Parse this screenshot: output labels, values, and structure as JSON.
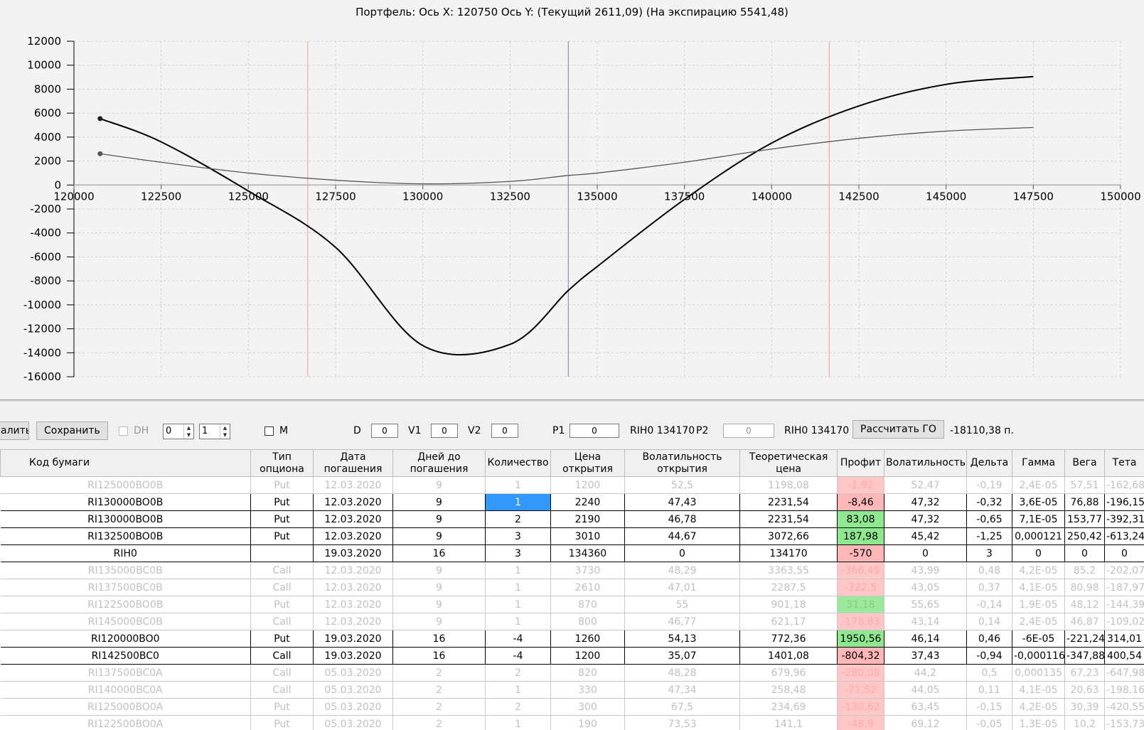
{
  "chart": {
    "title": "Портфель: Ось X: 120750 Ось Y:  (Текущий 2611,09)  (На экспирацию 5541,48)"
  },
  "chart_data": {
    "type": "line",
    "title": "Портфель: Ось X: 120750 Ось Y:  (Текущий 2611,09)  (На экспирацию 5541,48)",
    "xlabel": "",
    "ylabel": "",
    "xlim": [
      120000,
      150000
    ],
    "ylim": [
      -16000,
      12000
    ],
    "x_ticks": [
      "120000",
      "122500",
      "125000",
      "127500",
      "130000",
      "132500",
      "135000",
      "137500",
      "140000",
      "142500",
      "145000",
      "147500",
      "150000"
    ],
    "y_ticks": [
      "12000",
      "10000",
      "8000",
      "6000",
      "4000",
      "2000",
      "0",
      "-2000",
      "-4000",
      "-6000",
      "-8000",
      "-10000",
      "-12000",
      "-14000",
      "-16000"
    ],
    "grid": true,
    "vertical_markers": [
      {
        "x": 126700,
        "color": "#ff9999"
      },
      {
        "x": 134170,
        "color": "#7a7a90"
      },
      {
        "x": 141650,
        "color": "#ff9999"
      }
    ],
    "series": [
      {
        "color": "#000000",
        "points": [
          [
            120750,
            5541
          ],
          [
            122500,
            3600
          ],
          [
            125000,
            -500
          ],
          [
            127500,
            -5200
          ],
          [
            130000,
            -13400
          ],
          [
            132500,
            -13300
          ],
          [
            134170,
            -8800
          ],
          [
            135000,
            -6800
          ],
          [
            137500,
            -1200
          ],
          [
            140000,
            3500
          ],
          [
            142500,
            6600
          ],
          [
            145000,
            8400
          ],
          [
            147500,
            9050
          ]
        ]
      },
      {
        "color": "#555555",
        "points": [
          [
            120750,
            2611
          ],
          [
            122500,
            1900
          ],
          [
            125000,
            1000
          ],
          [
            127500,
            400
          ],
          [
            130000,
            100
          ],
          [
            132500,
            300
          ],
          [
            134170,
            800
          ],
          [
            135000,
            1000
          ],
          [
            137500,
            1900
          ],
          [
            140000,
            3000
          ],
          [
            142500,
            3900
          ],
          [
            145000,
            4500
          ],
          [
            147500,
            4800
          ]
        ]
      }
    ]
  },
  "toolbar": {
    "delete_label": "алить",
    "save_label": "Сохранить",
    "dh_label": "DH",
    "spin1_value": "0",
    "spin2_value": "1",
    "m_label": "M",
    "d_label": "D",
    "d_value": "0",
    "v1_label": "V1",
    "v1_value": "0",
    "v2_label": "V2",
    "v2_value": "0",
    "p1_label": "P1",
    "p1_value": "0",
    "p1_instrument": "RIH0 134170",
    "p2_label": "P2",
    "p2_value": "0",
    "p2_instrument": "RIH0 134170",
    "calc_label": "Рассчитать ГО",
    "result": "-18110,38 п."
  },
  "table": {
    "headers": [
      "Код бумаги",
      "Тип\nопциона",
      "Дата\nпогашения",
      "Дней до\nпогашения",
      "Количество",
      "Цена\nоткрытия",
      "Волатильность\nоткрытия",
      "Теоретическая\nцена",
      "Профит",
      "Волатильность",
      "Дельта",
      "Гамма",
      "Вега",
      "Тета"
    ],
    "rows": [
      {
        "faded": true,
        "pl": "neg",
        "sel": false,
        "cells": [
          "RI125000BO0B",
          "Put",
          "12.03.2020",
          "9",
          "1",
          "1200",
          "52,5",
          "1198,08",
          "-1,92",
          "52,47",
          "-0,19",
          "2,4E-05",
          "57,51",
          "-162,68"
        ]
      },
      {
        "faded": false,
        "pl": "neg",
        "sel": true,
        "cells": [
          "RI130000BO0B",
          "Put",
          "12.03.2020",
          "9",
          "1",
          "2240",
          "47,43",
          "2231,54",
          "-8,46",
          "47,32",
          "-0,32",
          "3,6E-05",
          "76,88",
          "-196,15"
        ]
      },
      {
        "faded": false,
        "pl": "pos",
        "sel": false,
        "cells": [
          "RI130000BO0B",
          "Put",
          "12.03.2020",
          "9",
          "2",
          "2190",
          "46,78",
          "2231,54",
          "83,08",
          "47,32",
          "-0,65",
          "7,1E-05",
          "153,77",
          "-392,31"
        ]
      },
      {
        "faded": false,
        "pl": "pos",
        "sel": false,
        "cells": [
          "RI132500BO0B",
          "Put",
          "12.03.2020",
          "9",
          "3",
          "3010",
          "44,67",
          "3072,66",
          "187,98",
          "45,42",
          "-1,25",
          "0,000121",
          "250,42",
          "-613,24"
        ]
      },
      {
        "faded": false,
        "pl": "neg",
        "sel": false,
        "cells": [
          "RIH0",
          "",
          "19.03.2020",
          "16",
          "3",
          "134360",
          "0",
          "134170",
          "-570",
          "0",
          "3",
          "0",
          "0",
          "0"
        ]
      },
      {
        "faded": true,
        "pl": "neg",
        "sel": false,
        "cells": [
          "RI135000BC0B",
          "Call",
          "12.03.2020",
          "9",
          "1",
          "3730",
          "48,29",
          "3363,55",
          "-366,45",
          "43,99",
          "0,48",
          "4,2E-05",
          "85,2",
          "-202,07"
        ]
      },
      {
        "faded": true,
        "pl": "neg",
        "sel": false,
        "cells": [
          "RI137500BC0B",
          "Call",
          "12.03.2020",
          "9",
          "1",
          "2610",
          "47,01",
          "2287,5",
          "-322,5",
          "43,05",
          "0,37",
          "4,1E-05",
          "80,98",
          "-187,97"
        ]
      },
      {
        "faded": true,
        "pl": "pos",
        "sel": false,
        "cells": [
          "RI122500BO0B",
          "Put",
          "12.03.2020",
          "9",
          "1",
          "870",
          "55",
          "901,18",
          "31,18",
          "55,65",
          "-0,14",
          "1,9E-05",
          "48,12",
          "-144,39"
        ]
      },
      {
        "faded": true,
        "pl": "neg",
        "sel": false,
        "cells": [
          "RI145000BC0B",
          "Call",
          "12.03.2020",
          "9",
          "1",
          "800",
          "46,77",
          "621,17",
          "-178,83",
          "43,14",
          "0,14",
          "2,4E-05",
          "46,87",
          "-109,02"
        ]
      },
      {
        "faded": false,
        "pl": "pos",
        "sel": false,
        "cells": [
          "RI120000BO0",
          "Put",
          "19.03.2020",
          "16",
          "-4",
          "1260",
          "54,13",
          "772,36",
          "1950,56",
          "46,14",
          "0,46",
          "-6E-05",
          "-221,24",
          "314,01"
        ]
      },
      {
        "faded": false,
        "pl": "neg",
        "sel": false,
        "cells": [
          "RI142500BC0",
          "Call",
          "19.03.2020",
          "16",
          "-4",
          "1200",
          "35,07",
          "1401,08",
          "-804,32",
          "37,43",
          "-0,94",
          "-0,000116",
          "-347,88",
          "400,54"
        ]
      },
      {
        "faded": true,
        "pl": "neg",
        "sel": false,
        "cells": [
          "RI137500BC0A",
          "Call",
          "05.03.2020",
          "2",
          "2",
          "820",
          "48,28",
          "679,96",
          "-280,08",
          "44,2",
          "0,5",
          "0,000135",
          "67,23",
          "-647,98"
        ]
      },
      {
        "faded": true,
        "pl": "neg",
        "sel": false,
        "cells": [
          "RI140000BC0A",
          "Call",
          "05.03.2020",
          "2",
          "1",
          "330",
          "47,34",
          "258,48",
          "-71,52",
          "44,05",
          "0,11",
          "4,1E-05",
          "20,63",
          "-198,16"
        ]
      },
      {
        "faded": true,
        "pl": "neg",
        "sel": false,
        "cells": [
          "RI125000BO0A",
          "Put",
          "05.03.2020",
          "2",
          "2",
          "300",
          "67,5",
          "234,69",
          "-130,62",
          "63,45",
          "-0,15",
          "4,2E-05",
          "30,39",
          "-420,55"
        ]
      },
      {
        "faded": true,
        "pl": "neg",
        "sel": false,
        "cells": [
          "RI122500BO0A",
          "Put",
          "05.03.2020",
          "2",
          "1",
          "190",
          "73,53",
          "141,1",
          "-48,9",
          "69,12",
          "-0,05",
          "1,3E-05",
          "10,2",
          "-153,73"
        ]
      }
    ]
  }
}
